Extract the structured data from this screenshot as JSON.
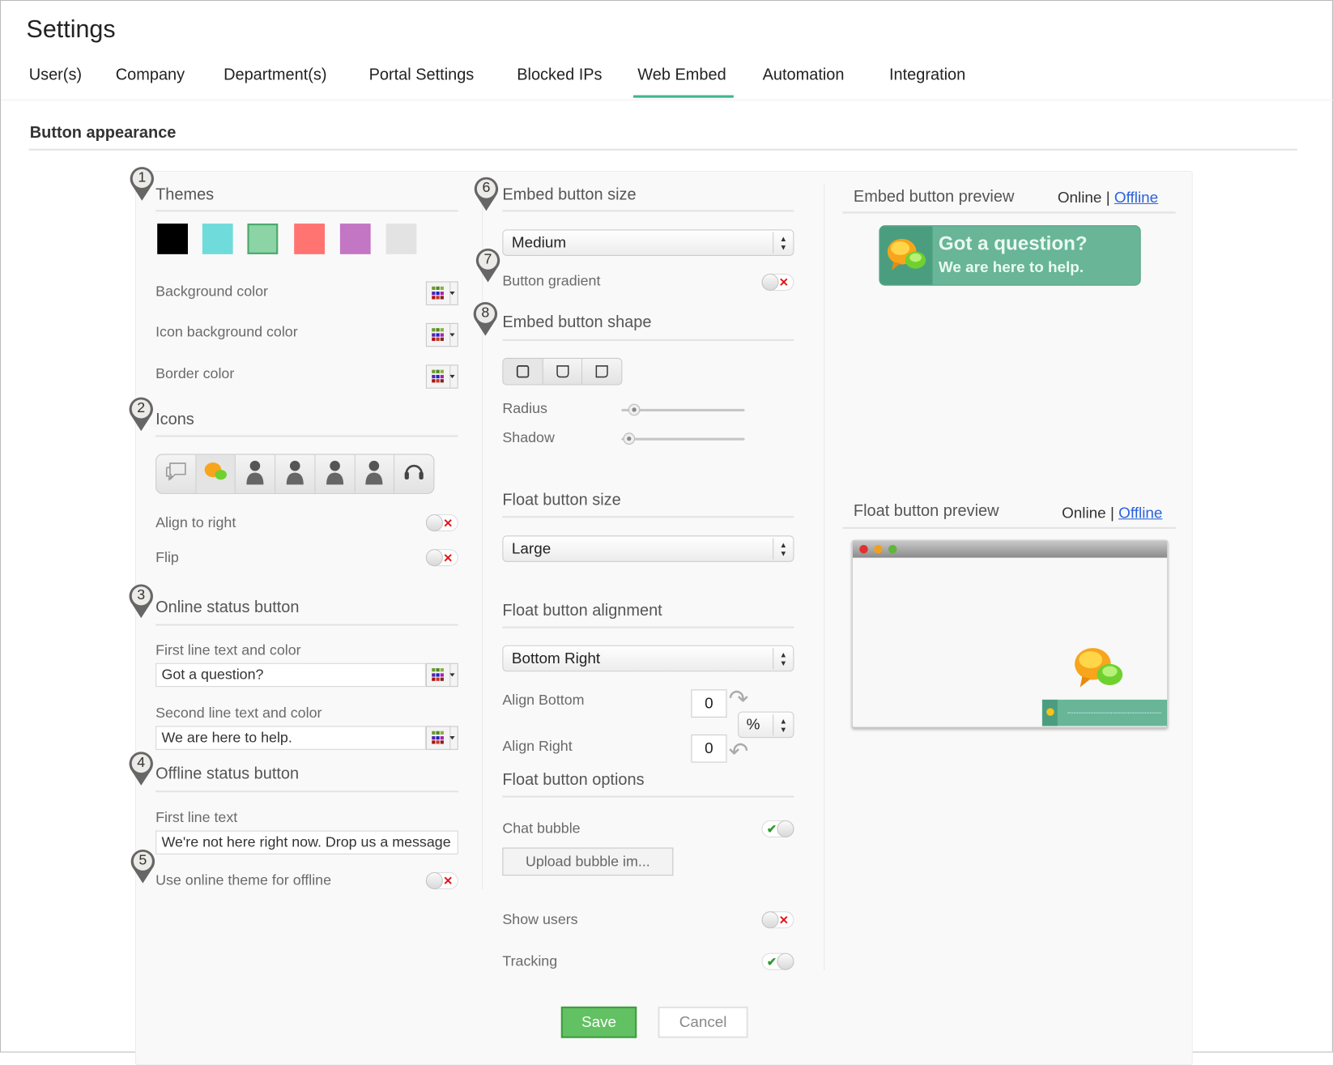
{
  "header": {
    "title": "Settings"
  },
  "tabs": [
    {
      "label": "User(s)"
    },
    {
      "label": "Company"
    },
    {
      "label": "Department(s)"
    },
    {
      "label": "Portal Settings"
    },
    {
      "label": "Blocked IPs"
    },
    {
      "label": "Web Embed",
      "active": true
    },
    {
      "label": "Automation"
    },
    {
      "label": "Integration"
    }
  ],
  "section_title": "Button appearance",
  "accent_color": "#3fb68e",
  "left": {
    "themes": {
      "marker": "1",
      "title": "Themes",
      "swatches": [
        "#000000",
        "#6fdbdb",
        "#8cd4a5",
        "#ff7370",
        "#c376c3",
        "#e3e3e3"
      ],
      "selected_index": 2
    },
    "background_color_label": "Background color",
    "icon_background_color_label": "Icon background color",
    "border_color_label": "Border color",
    "icons": {
      "marker": "2",
      "title": "Icons",
      "items": [
        "chat-bubble-outline-icon",
        "chat-bubbles-color-icon",
        "user-female-icon",
        "user-female-2-icon",
        "user-male-icon",
        "user-male-2-icon",
        "headset-icon"
      ],
      "selected_index": 1
    },
    "align_to_right": {
      "label": "Align to right",
      "on": false
    },
    "flip": {
      "label": "Flip",
      "on": false
    },
    "online": {
      "marker": "3",
      "title": "Online status button",
      "first_label": "First line text and color",
      "first_value": "Got a question?",
      "second_label": "Second line text and color",
      "second_value": "We are here to help."
    },
    "offline": {
      "marker": "4",
      "title": "Offline status button",
      "first_label": "First line text",
      "first_value": "We're not here right now. Drop us a message"
    },
    "use_online_theme": {
      "marker": "5",
      "label": "Use online theme for offline",
      "on": false
    }
  },
  "middle": {
    "embed_size": {
      "marker": "6",
      "title": "Embed button size",
      "value": "Medium"
    },
    "gradient": {
      "marker": "7",
      "label": "Button gradient",
      "on": false
    },
    "shape": {
      "marker": "8",
      "title": "Embed button shape",
      "options": [
        "square",
        "rounded",
        "rounded-corner"
      ],
      "selected_index": 0
    },
    "radius": {
      "label": "Radius",
      "value": 5
    },
    "shadow": {
      "label": "Shadow",
      "value": 0
    },
    "float_size": {
      "title": "Float button size",
      "value": "Large"
    },
    "float_alignment": {
      "title": "Float button alignment",
      "value": "Bottom Right"
    },
    "align_bottom": {
      "label": "Align Bottom",
      "value": "0"
    },
    "align_right": {
      "label": "Align Right",
      "value": "0"
    },
    "unit": "%",
    "float_options": {
      "title": "Float button options"
    },
    "chat_bubble": {
      "label": "Chat bubble",
      "on": true
    },
    "upload_label": "Upload bubble im...",
    "show_users": {
      "label": "Show users",
      "on": false
    },
    "tracking": {
      "label": "Tracking",
      "on": true
    }
  },
  "right": {
    "embed_preview": {
      "title": "Embed button preview",
      "online": "Online",
      "sep": "|",
      "offline": "Offline",
      "line1": "Got a question?",
      "line2": "We are here to help.",
      "bg_color": "#68b598"
    },
    "float_preview": {
      "title": "Float button preview",
      "online": "Online",
      "sep": "|",
      "offline": "Offline"
    }
  },
  "actions": {
    "save": "Save",
    "cancel": "Cancel",
    "save_color": "#62c162"
  }
}
